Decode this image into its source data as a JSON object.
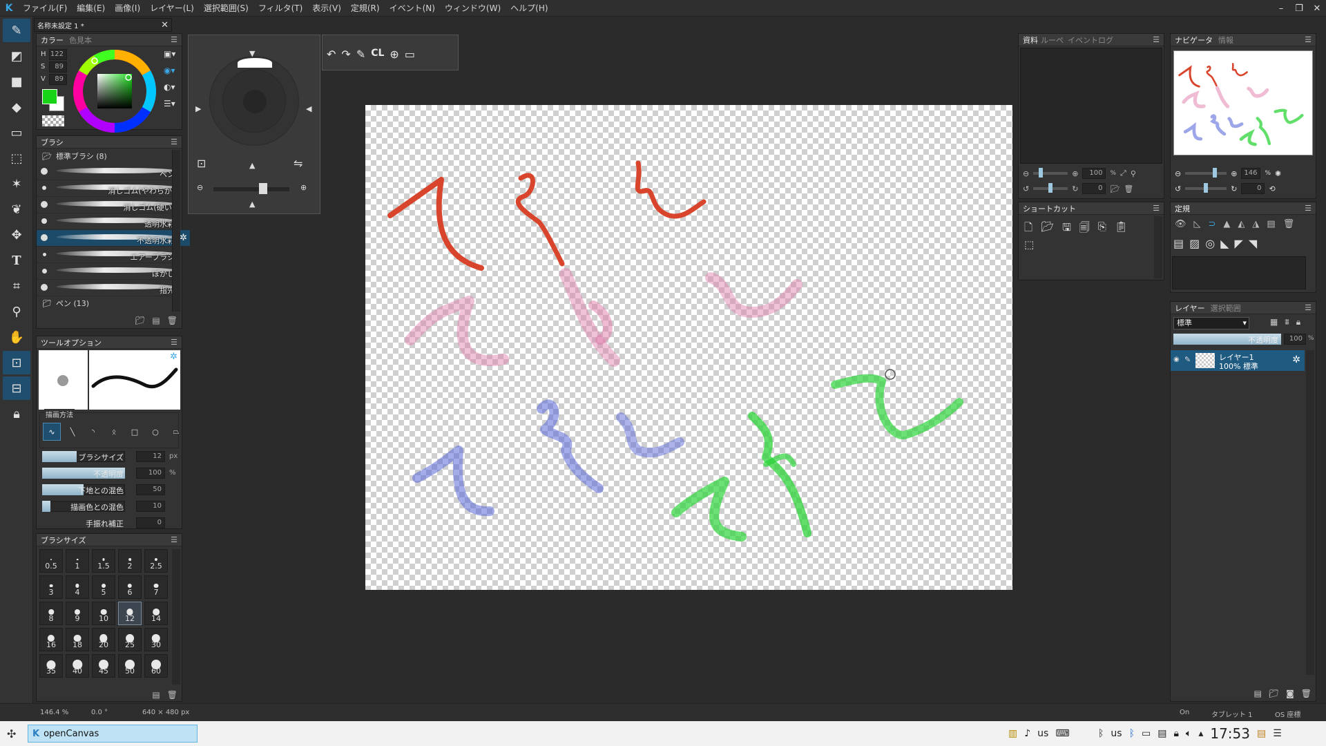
{
  "menubar": {
    "items": [
      "ファイル(F)",
      "編集(E)",
      "画像(I)",
      "レイヤー(L)",
      "選択範囲(S)",
      "フィルタ(T)",
      "表示(V)",
      "定規(R)",
      "イベント(N)",
      "ウィンドウ(W)",
      "ヘルプ(H)"
    ]
  },
  "document_tab": "名称未設定 1 *",
  "color_panel": {
    "tab_active": "カラー",
    "tab_inactive": "色見本",
    "h_label": "H",
    "h_value": "122",
    "s_label": "S",
    "s_value": "89",
    "v_label": "V",
    "v_value": "89",
    "foreground_color": "#17d417"
  },
  "brush_panel": {
    "title": "ブラシ",
    "group_open": "標準ブラシ (8)",
    "brushes": [
      "ペン",
      "消しゴム(やわらか)",
      "消しゴム(硬い)",
      "透明水彩",
      "不透明水彩",
      "エアーブラシ",
      "ぼかし",
      "指先"
    ],
    "group_closed": "ペン (13)"
  },
  "tool_options": {
    "title": "ツールオプション",
    "draw_method_label": "描画方法",
    "brush_size_label": "ブラシサイズ",
    "brush_size_value": "12",
    "brush_size_unit": "px",
    "brush_size_level": 0.42,
    "opacity_label": "不透明度",
    "opacity_value": "100",
    "opacity_unit": "%",
    "opacity_level": 1.0,
    "base_mix_label": "下地との混色",
    "base_mix_value": "50",
    "base_mix_level": 0.5,
    "draw_mix_label": "描画色との混色",
    "draw_mix_value": "10",
    "draw_mix_level": 0.1,
    "stabilizer_label": "手振れ補正",
    "stabilizer_value": "0"
  },
  "brush_size_panel": {
    "title": "ブラシサイズ",
    "sizes": [
      "0.5",
      "1",
      "1.5",
      "2",
      "2.5",
      "3",
      "4",
      "5",
      "6",
      "7",
      "8",
      "9",
      "10",
      "12",
      "14",
      "16",
      "18",
      "20",
      "25",
      "30",
      "35",
      "40",
      "45",
      "50",
      "60"
    ],
    "selected": "12"
  },
  "float_toolbar": {
    "cl_label": "CL"
  },
  "reference_panel": {
    "tab_active": "資料",
    "tab2": "ルーペ",
    "tab3": "イベントログ",
    "zoom_value": "100",
    "zoom_unit": "%",
    "rotate_value": "0"
  },
  "shortcut_panel": {
    "title": "ショートカット"
  },
  "navigator_panel": {
    "tab_active": "ナビゲータ",
    "tab_inactive": "情報",
    "zoom_value": "146",
    "zoom_unit": "%",
    "rotate_value": "0"
  },
  "ruler_panel": {
    "title": "定規"
  },
  "layer_panel": {
    "tab_active": "レイヤー",
    "tab_inactive": "選択範囲",
    "blend_mode": "標準",
    "opacity_label": "不透明度",
    "opacity_value": "100",
    "opacity_unit": "%",
    "layers": [
      {
        "name": "レイヤー1",
        "info": "100% 標準"
      }
    ]
  },
  "statusbar": {
    "zoom": "146.4 %",
    "angle": "0.0 °",
    "size": "640 × 480 px",
    "tablet_state": "On",
    "tablet_label": "タブレット 1",
    "os_label": "OS 座標"
  },
  "taskbar": {
    "app_name": "openCanvas",
    "keyboard1": "us",
    "keyboard2": "us",
    "clock": "17:53"
  },
  "colors": {
    "accent": "#3aa7e6",
    "red_stroke": "#d8452c",
    "pink_stroke": "#e07aa8",
    "blue_stroke": "#5a6ad8",
    "green_stroke": "#2ed43a"
  }
}
